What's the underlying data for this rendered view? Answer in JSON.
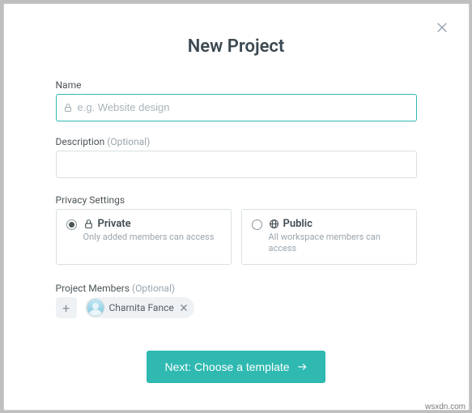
{
  "modal": {
    "title": "New Project",
    "name_label": "Name",
    "name_placeholder": "e.g. Website design",
    "name_value": "",
    "description_label": "Description",
    "description_optional": "(Optional)",
    "description_value": "",
    "privacy_label": "Privacy Settings",
    "privacy": {
      "private": {
        "title": "Private",
        "subtitle": "Only added members can access",
        "selected": true
      },
      "public": {
        "title": "Public",
        "subtitle": "All workspace members can access",
        "selected": false
      }
    },
    "members_label": "Project Members",
    "members_optional": "(Optional)",
    "members": [
      {
        "name": "Charnita Fance"
      }
    ],
    "add_member_label": "+",
    "next_button": "Next: Choose a template"
  },
  "watermark": "wsxdn.com",
  "colors": {
    "accent": "#2fb9b1"
  }
}
